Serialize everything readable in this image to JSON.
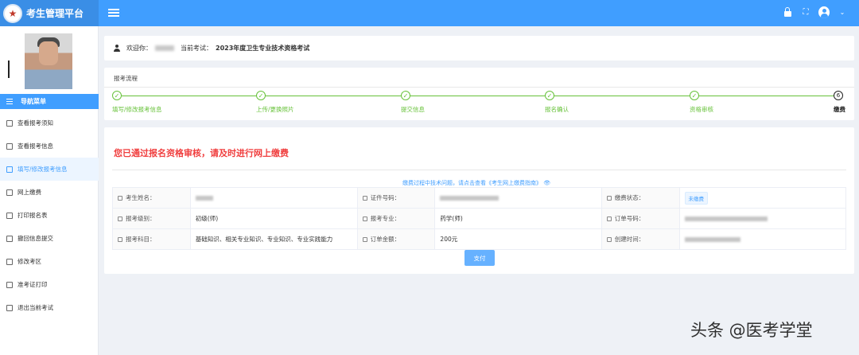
{
  "app": {
    "title": "考生管理平台"
  },
  "header": {
    "icons": [
      "lock-icon",
      "fullscreen-icon",
      "user-avatar-icon",
      "caret-down-icon"
    ]
  },
  "sidebar": {
    "nav_title": "导航菜单",
    "items": [
      {
        "label": "查看报考须知",
        "icon": "notice-icon",
        "active": false
      },
      {
        "label": "查看报考信息",
        "icon": "document-icon",
        "active": false
      },
      {
        "label": "填写/修改报考信息",
        "icon": "edit-icon",
        "active": true
      },
      {
        "label": "网上缴费",
        "icon": "payment-icon",
        "active": false
      },
      {
        "label": "打印报名表",
        "icon": "print-icon",
        "active": false
      },
      {
        "label": "撤回信息提交",
        "icon": "undo-icon",
        "active": false
      },
      {
        "label": "修改考区",
        "icon": "swap-icon",
        "active": false
      },
      {
        "label": "准考证打印",
        "icon": "ticket-icon",
        "active": false
      },
      {
        "label": "退出当前考试",
        "icon": "exit-icon",
        "active": false
      }
    ]
  },
  "welcome": {
    "prefix": "欢迎你：",
    "exam_prefix": "当前考试：",
    "exam_name": "2023年度卫生专业技术资格考试"
  },
  "process": {
    "title": "报考流程",
    "steps": [
      {
        "label": "填写/修改报考信息",
        "status": "done"
      },
      {
        "label": "上传/更换照片",
        "status": "done"
      },
      {
        "label": "提交信息",
        "status": "done"
      },
      {
        "label": "报名确认",
        "status": "done"
      },
      {
        "label": "资格审核",
        "status": "done"
      },
      {
        "label": "缴费",
        "status": "current",
        "number": "6"
      }
    ],
    "check_glyph": "✓"
  },
  "main": {
    "status_message": "您已通过报名资格审核，请及时进行网上缴费",
    "help_link": "缴费过程中技术问题，请点击查看《考生网上缴费指南》 👁",
    "rows": [
      [
        {
          "label": "考生姓名：",
          "value": ""
        },
        {
          "label": "证件号码：",
          "value": ""
        },
        {
          "label": "缴费状态：",
          "value": "未缴费",
          "badge": true
        }
      ],
      [
        {
          "label": "报考级别：",
          "value": "初级(师)"
        },
        {
          "label": "报考专业：",
          "value": "药学(师)"
        },
        {
          "label": "订单号码：",
          "value": ""
        }
      ],
      [
        {
          "label": "报考科目：",
          "value": "基础知识、相关专业知识、专业知识、专业实践能力"
        },
        {
          "label": "订单金额：",
          "value": "200元"
        },
        {
          "label": "创建时间：",
          "value": ""
        }
      ]
    ],
    "pay_button": "支付"
  },
  "watermark": "头条 @医考学堂"
}
